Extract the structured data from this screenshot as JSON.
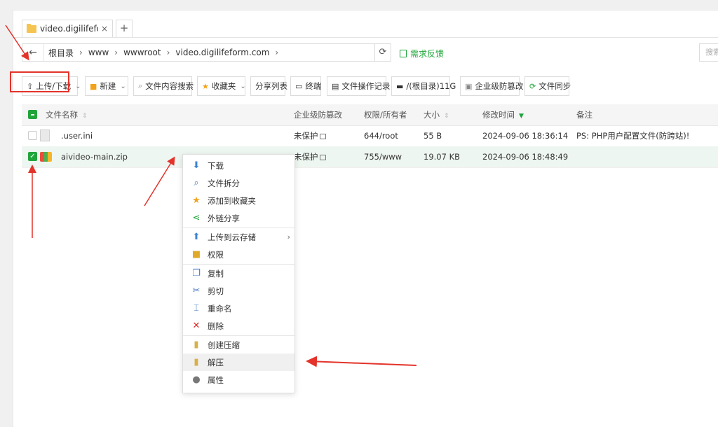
{
  "tab": {
    "title": "video.digilifefor...",
    "close": "×",
    "add": "+"
  },
  "path": {
    "back": "←",
    "crumbs": [
      "根目录",
      "www",
      "wwwroot",
      "video.digilifeform.com"
    ],
    "sep": "›",
    "refresh": "⟳"
  },
  "feedback": "需求反馈",
  "search_placeholder": "搜索",
  "toolbar": [
    {
      "label": "上传/下载",
      "icon": "upload-icon",
      "caret": true
    },
    {
      "label": "新建",
      "icon": "new-folder-icon",
      "caret": true
    },
    {
      "label": "文件内容搜索",
      "icon": "search-icon"
    },
    {
      "label": "收藏夹",
      "icon": "star-icon",
      "caret": true
    },
    {
      "label": "分享列表",
      "icon": ""
    },
    {
      "label": "终端",
      "icon": "terminal-icon"
    },
    {
      "label": "文件操作记录",
      "icon": "log-icon"
    },
    {
      "label": "/(根目录)11G",
      "icon": "disk-icon"
    },
    {
      "label": "企业级防篡改",
      "icon": "shield-icon"
    },
    {
      "label": "文件同步",
      "icon": "sync-icon"
    }
  ],
  "table": {
    "headers": {
      "name": "文件名称",
      "tamper": "企业级防篡改",
      "perm": "权限/所有者",
      "size": "大小",
      "mtime": "修改时间",
      "note": "备注"
    },
    "rows": [
      {
        "name": ".user.ini",
        "tamper": "未保护",
        "perm": "644/root",
        "size": "55 B",
        "mtime": "2024-09-06 18:36:14",
        "note": "PS: PHP用户配置文件(防跨站)!",
        "checked": false,
        "icon": "document-icon"
      },
      {
        "name": "aivideo-main.zip",
        "tamper": "未保护",
        "perm": "755/www",
        "size": "19.07 KB",
        "mtime": "2024-09-06 18:48:49",
        "note": "",
        "checked": true,
        "icon": "zip-archive-icon"
      }
    ]
  },
  "context_menu": [
    {
      "label": "下载",
      "icon": "download-arrow-icon",
      "color": "#3b82d6"
    },
    {
      "label": "文件拆分",
      "icon": "magnifier-icon",
      "color": "#4a7fc1"
    },
    {
      "label": "添加到收藏夹",
      "icon": "star-icon",
      "color": "#f2a31b"
    },
    {
      "label": "外链分享",
      "icon": "share-icon",
      "color": "#20a53a"
    },
    {
      "label": "上传到云存储",
      "icon": "upload-arrow-icon",
      "color": "#3b82d6",
      "submenu": true
    },
    {
      "label": "权限",
      "icon": "permission-folder-icon",
      "color": "#e0a929"
    },
    {
      "label": "复制",
      "icon": "copy-icon",
      "color": "#4a7fc1"
    },
    {
      "label": "剪切",
      "icon": "scissors-icon",
      "color": "#4a7fc1"
    },
    {
      "label": "重命名",
      "icon": "rename-icon",
      "color": "#4a7fc1"
    },
    {
      "label": "删除",
      "icon": "delete-x-icon",
      "color": "#e02a2a"
    },
    {
      "label": "创建压缩",
      "icon": "zip-icon",
      "color": "#d8b048"
    },
    {
      "label": "解压",
      "icon": "unzip-icon",
      "color": "#d8b048",
      "hover": true
    },
    {
      "label": "属性",
      "icon": "info-icon",
      "color": "#777777"
    }
  ],
  "colors": {
    "accent": "#20a53a",
    "annotation": "#e3332a"
  }
}
